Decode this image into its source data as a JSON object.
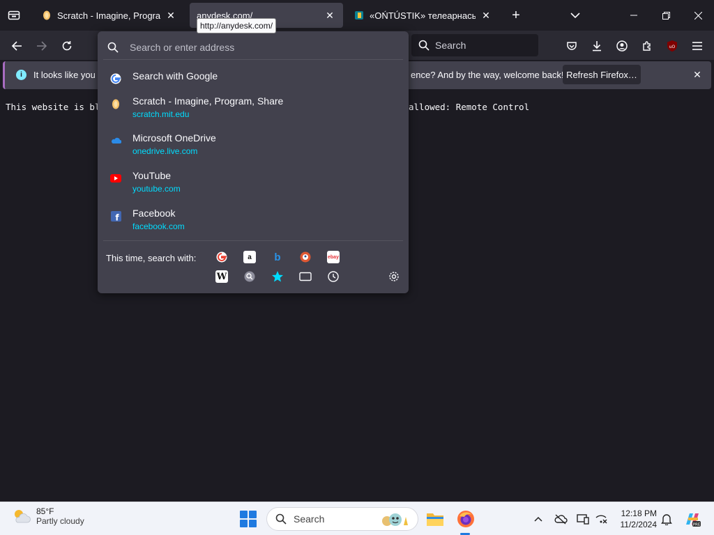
{
  "tabs": [
    {
      "title": "Scratch - Imagine, Program, Share",
      "active": false
    },
    {
      "title": "anydesk.com/",
      "active": true
    },
    {
      "title": "«OŃTÚSTIK» телеарнасының ресми сайты",
      "active": false
    }
  ],
  "tooltip": "http://anydesk.com/",
  "toolbar": {
    "search_placeholder": "Search"
  },
  "notification": {
    "message_start": "It looks like you ha",
    "message_end": "ence? And by the way, welcome back!",
    "refresh_label": "Refresh Firefox…"
  },
  "page": {
    "blocked_text_start": "This website is blo",
    "blocked_text_end": "allowed: Remote Control"
  },
  "urlbar": {
    "placeholder": "Search or enter address",
    "results": [
      {
        "title": "Search with Google",
        "url": ""
      },
      {
        "title": "Scratch - Imagine, Program, Share",
        "url": "scratch.mit.edu"
      },
      {
        "title": "Microsoft OneDrive",
        "url": "onedrive.live.com"
      },
      {
        "title": "YouTube",
        "url": "youtube.com"
      },
      {
        "title": "Facebook",
        "url": "facebook.com"
      }
    ],
    "one_off_label": "This time, search with:",
    "engines": [
      "google-icon",
      "amazon-icon",
      "bing-icon",
      "duckduckgo-icon",
      "ebay-icon",
      "wikipedia-icon",
      "search-engine-icon",
      "bookmarks-icon",
      "tabs-icon",
      "history-icon"
    ]
  },
  "taskbar": {
    "temperature": "85°F",
    "condition": "Partly cloudy",
    "search_label": "Search",
    "time": "12:18 PM",
    "date": "11/2/2024"
  },
  "colors": {
    "accent": "#00ddff",
    "frame": "#1f1e25",
    "toolbar": "#2b2a33",
    "popup": "#42414d"
  }
}
